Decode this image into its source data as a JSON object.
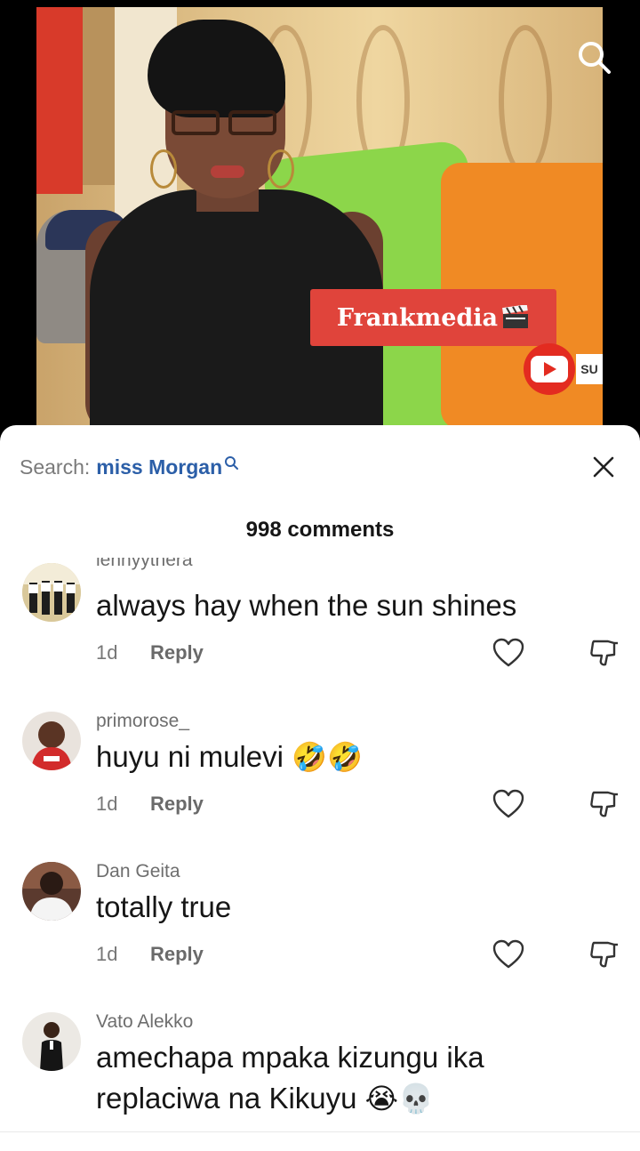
{
  "video": {
    "channel_label": "Frankmedia",
    "subscribe_tab": "SU"
  },
  "comments_panel": {
    "search_prefix": "Search:",
    "search_term": "miss Morgan",
    "count_label": "998 comments",
    "reply_label": "Reply",
    "comments": [
      {
        "username": "lennyythera",
        "text": "always hay when the sun shines",
        "age": "1d"
      },
      {
        "username": "primorose_",
        "text": "huyu ni mulevi",
        "emoji": "🤣🤣",
        "age": "1d"
      },
      {
        "username": "Dan Geita",
        "text": "totally true",
        "age": "1d"
      },
      {
        "username": "Vato Alekko",
        "text_line1": "amechapa mpaka kizungu ika",
        "text_line2": "replaciwa na Kikuyu",
        "emoji": "😭💀"
      }
    ]
  },
  "colors": {
    "search_term": "#2c5fa8",
    "brand_label_bg": "#e0443b",
    "youtube_red": "#e32b20"
  },
  "icons": [
    "search-icon",
    "close-icon",
    "heart-icon",
    "dislike-icon",
    "youtube-logo-icon",
    "clapperboard-icon"
  ]
}
